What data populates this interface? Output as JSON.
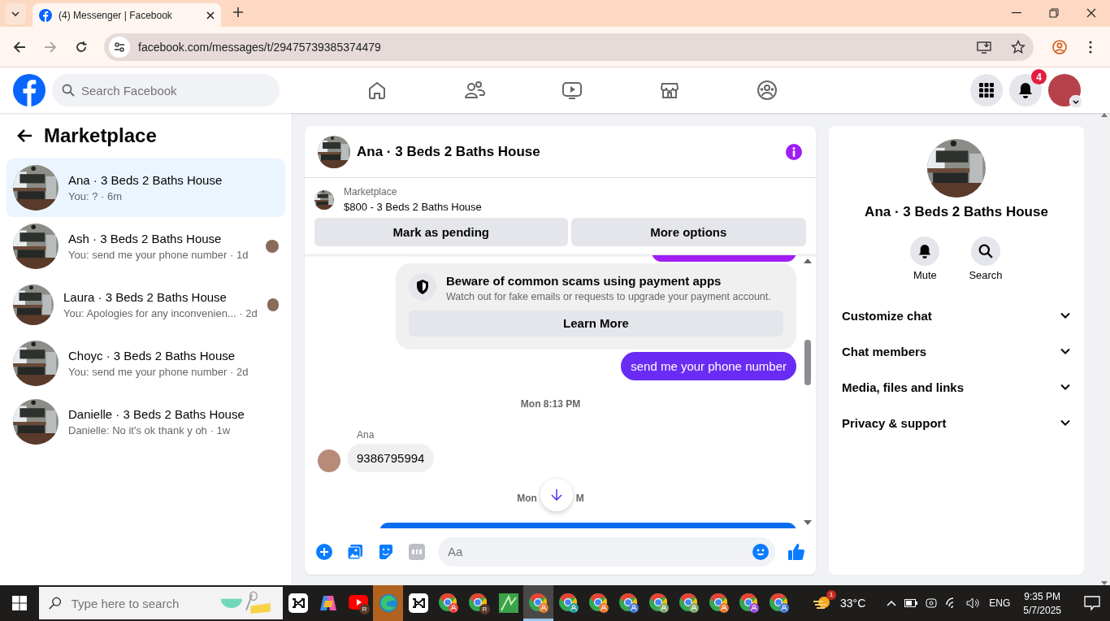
{
  "browser": {
    "tab_title": "(4) Messenger | Facebook",
    "url": "facebook.com/messages/t/29475739385374479"
  },
  "header": {
    "search_placeholder": "Search Facebook",
    "notification_count": "4"
  },
  "sidebar": {
    "title": "Marketplace",
    "conversations": [
      {
        "name": "Ana · 3 Beds 2 Baths House",
        "preview": "You: ? · 6m",
        "selected": true,
        "seen": false
      },
      {
        "name": "Ash · 3 Beds 2 Baths House",
        "preview": "You: send me your phone number · 1d",
        "selected": false,
        "seen": true
      },
      {
        "name": "Laura · 3 Beds 2 Baths House",
        "preview": "You: Apologies for any inconvenien... · 2d",
        "selected": false,
        "seen": true
      },
      {
        "name": "Choyc · 3 Beds 2 Baths House",
        "preview": "You: send me your phone number · 2d",
        "selected": false,
        "seen": false
      },
      {
        "name": "Danielle · 3 Beds 2 Baths House",
        "preview": "Danielle: No it's ok thank y oh · 1w",
        "selected": false,
        "seen": false
      }
    ]
  },
  "chat": {
    "title": "Ana · 3 Beds 2 Baths House",
    "listing_label": "Marketplace",
    "listing": "$800 - 3 Beds 2 Baths House",
    "buttons": [
      "Mark as pending",
      "More options"
    ],
    "messages": [
      {
        "kind": "edge",
        "color": "#a01ef5"
      },
      {
        "kind": "notice",
        "title": "Beware of common scams using payment apps",
        "body": "Watch out for fake emails or requests to upgrade your payment account.",
        "action": "Learn More"
      },
      {
        "kind": "outgoing",
        "text": "send me your phone number"
      },
      {
        "kind": "timestamp",
        "text": "Mon 8:13 PM"
      },
      {
        "kind": "incoming",
        "sender": "Ana",
        "text": "9386795994"
      },
      {
        "kind": "covered-timestamp",
        "left": "Mon",
        "right": "M"
      },
      {
        "kind": "edge",
        "color": "#0a6cf0"
      }
    ],
    "composer_placeholder": "Aa"
  },
  "info": {
    "name": "Ana · 3 Beds 2 Baths House",
    "actions": [
      {
        "kind": "mute",
        "label": "Mute"
      },
      {
        "kind": "search",
        "label": "Search"
      }
    ],
    "sections": [
      {
        "label": "Customize chat",
        "expanded": false
      },
      {
        "label": "Chat members",
        "expanded": false
      },
      {
        "label": "Media, files and links",
        "expanded": false
      },
      {
        "label": "Privacy & support",
        "expanded": false
      }
    ]
  },
  "taskbar": {
    "search_placeholder": "Type here to search",
    "apps": [
      {
        "kind": "capcut",
        "selected": false,
        "attention": false
      },
      {
        "kind": "copilot",
        "selected": false,
        "attention": false
      },
      {
        "kind": "youtube",
        "badge": "R",
        "selected": false,
        "attention": false
      },
      {
        "kind": "edge",
        "selected": false,
        "attention": true
      },
      {
        "kind": "capcut",
        "selected": false,
        "attention": false
      },
      {
        "kind": "chrome",
        "color": "#e8453c",
        "selected": false,
        "attention": false
      },
      {
        "kind": "chrome",
        "badge": "R",
        "selected": false,
        "attention": false
      },
      {
        "kind": "sheets",
        "selected": false,
        "attention": false
      },
      {
        "kind": "chrome",
        "color": "#e8772e",
        "selected": true,
        "attention": false
      },
      {
        "kind": "chrome",
        "color": "#2a9d9a",
        "selected": false,
        "attention": false
      },
      {
        "kind": "chrome",
        "color": "#e8772e",
        "selected": false,
        "attention": false
      },
      {
        "kind": "chrome",
        "color": "#4a78d8",
        "selected": false,
        "attention": false
      },
      {
        "kind": "chrome",
        "color": "#7fa86a",
        "selected": false,
        "attention": false
      },
      {
        "kind": "chrome",
        "color": "#7fa86a",
        "selected": false,
        "attention": false
      },
      {
        "kind": "chrome",
        "color": "#e8772e",
        "selected": false,
        "attention": false
      },
      {
        "kind": "chrome",
        "color": "#9a4fd8",
        "selected": false,
        "attention": false
      },
      {
        "kind": "chrome",
        "color": "#4a78d8",
        "selected": false,
        "attention": false
      }
    ],
    "weather_badge": "1",
    "temperature": "33°C",
    "language": "ENG",
    "time": "9:35 PM",
    "date": "5/7/2025"
  }
}
